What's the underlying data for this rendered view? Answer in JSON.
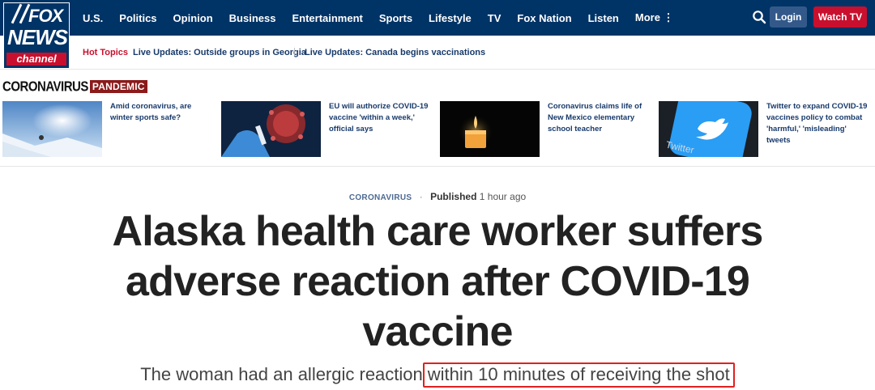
{
  "logo": {
    "fox": "FOX",
    "news": "NEWS",
    "channel": "channel"
  },
  "nav": {
    "items": [
      "U.S.",
      "Politics",
      "Opinion",
      "Business",
      "Entertainment",
      "Sports",
      "Lifestyle",
      "TV",
      "Fox Nation",
      "Listen"
    ],
    "more_label": "More ⋮",
    "login_label": "Login",
    "watch_label": "Watch TV"
  },
  "hot_topics": {
    "label": "Hot Topics",
    "links": [
      "Live Updates: Outside groups in Georgia",
      "Live Updates: Canada begins vaccinations"
    ]
  },
  "banner": {
    "title": "CORONAVIRUS",
    "tag": "PANDEMIC"
  },
  "stories": [
    {
      "title": "Amid coronavirus, are winter sports safe?"
    },
    {
      "title": "EU will authorize COVID-19 vaccine 'within a week,' official says"
    },
    {
      "title": "Coronavirus claims life of New Mexico elementary school teacher"
    },
    {
      "title": "Twitter to expand COVID-19 vaccines policy to combat 'harmful,' 'misleading' tweets"
    }
  ],
  "article": {
    "eyebrow": "CORONAVIRUS",
    "published_label": "Published",
    "published_time": "1 hour ago",
    "headline": "Alaska health care worker suffers adverse reaction after COVID-19 vaccine",
    "subhead_start": "The woman had an allergic reaction",
    "subhead_highlight": "within 10 minutes of receiving the shot"
  },
  "colors": {
    "nav_bg": "#003366",
    "accent_red": "#c8102e",
    "link_blue": "#183a6b",
    "highlight_border": "#e02020"
  },
  "icons": {
    "search": "search-icon",
    "more": "vertical-dots-icon"
  }
}
